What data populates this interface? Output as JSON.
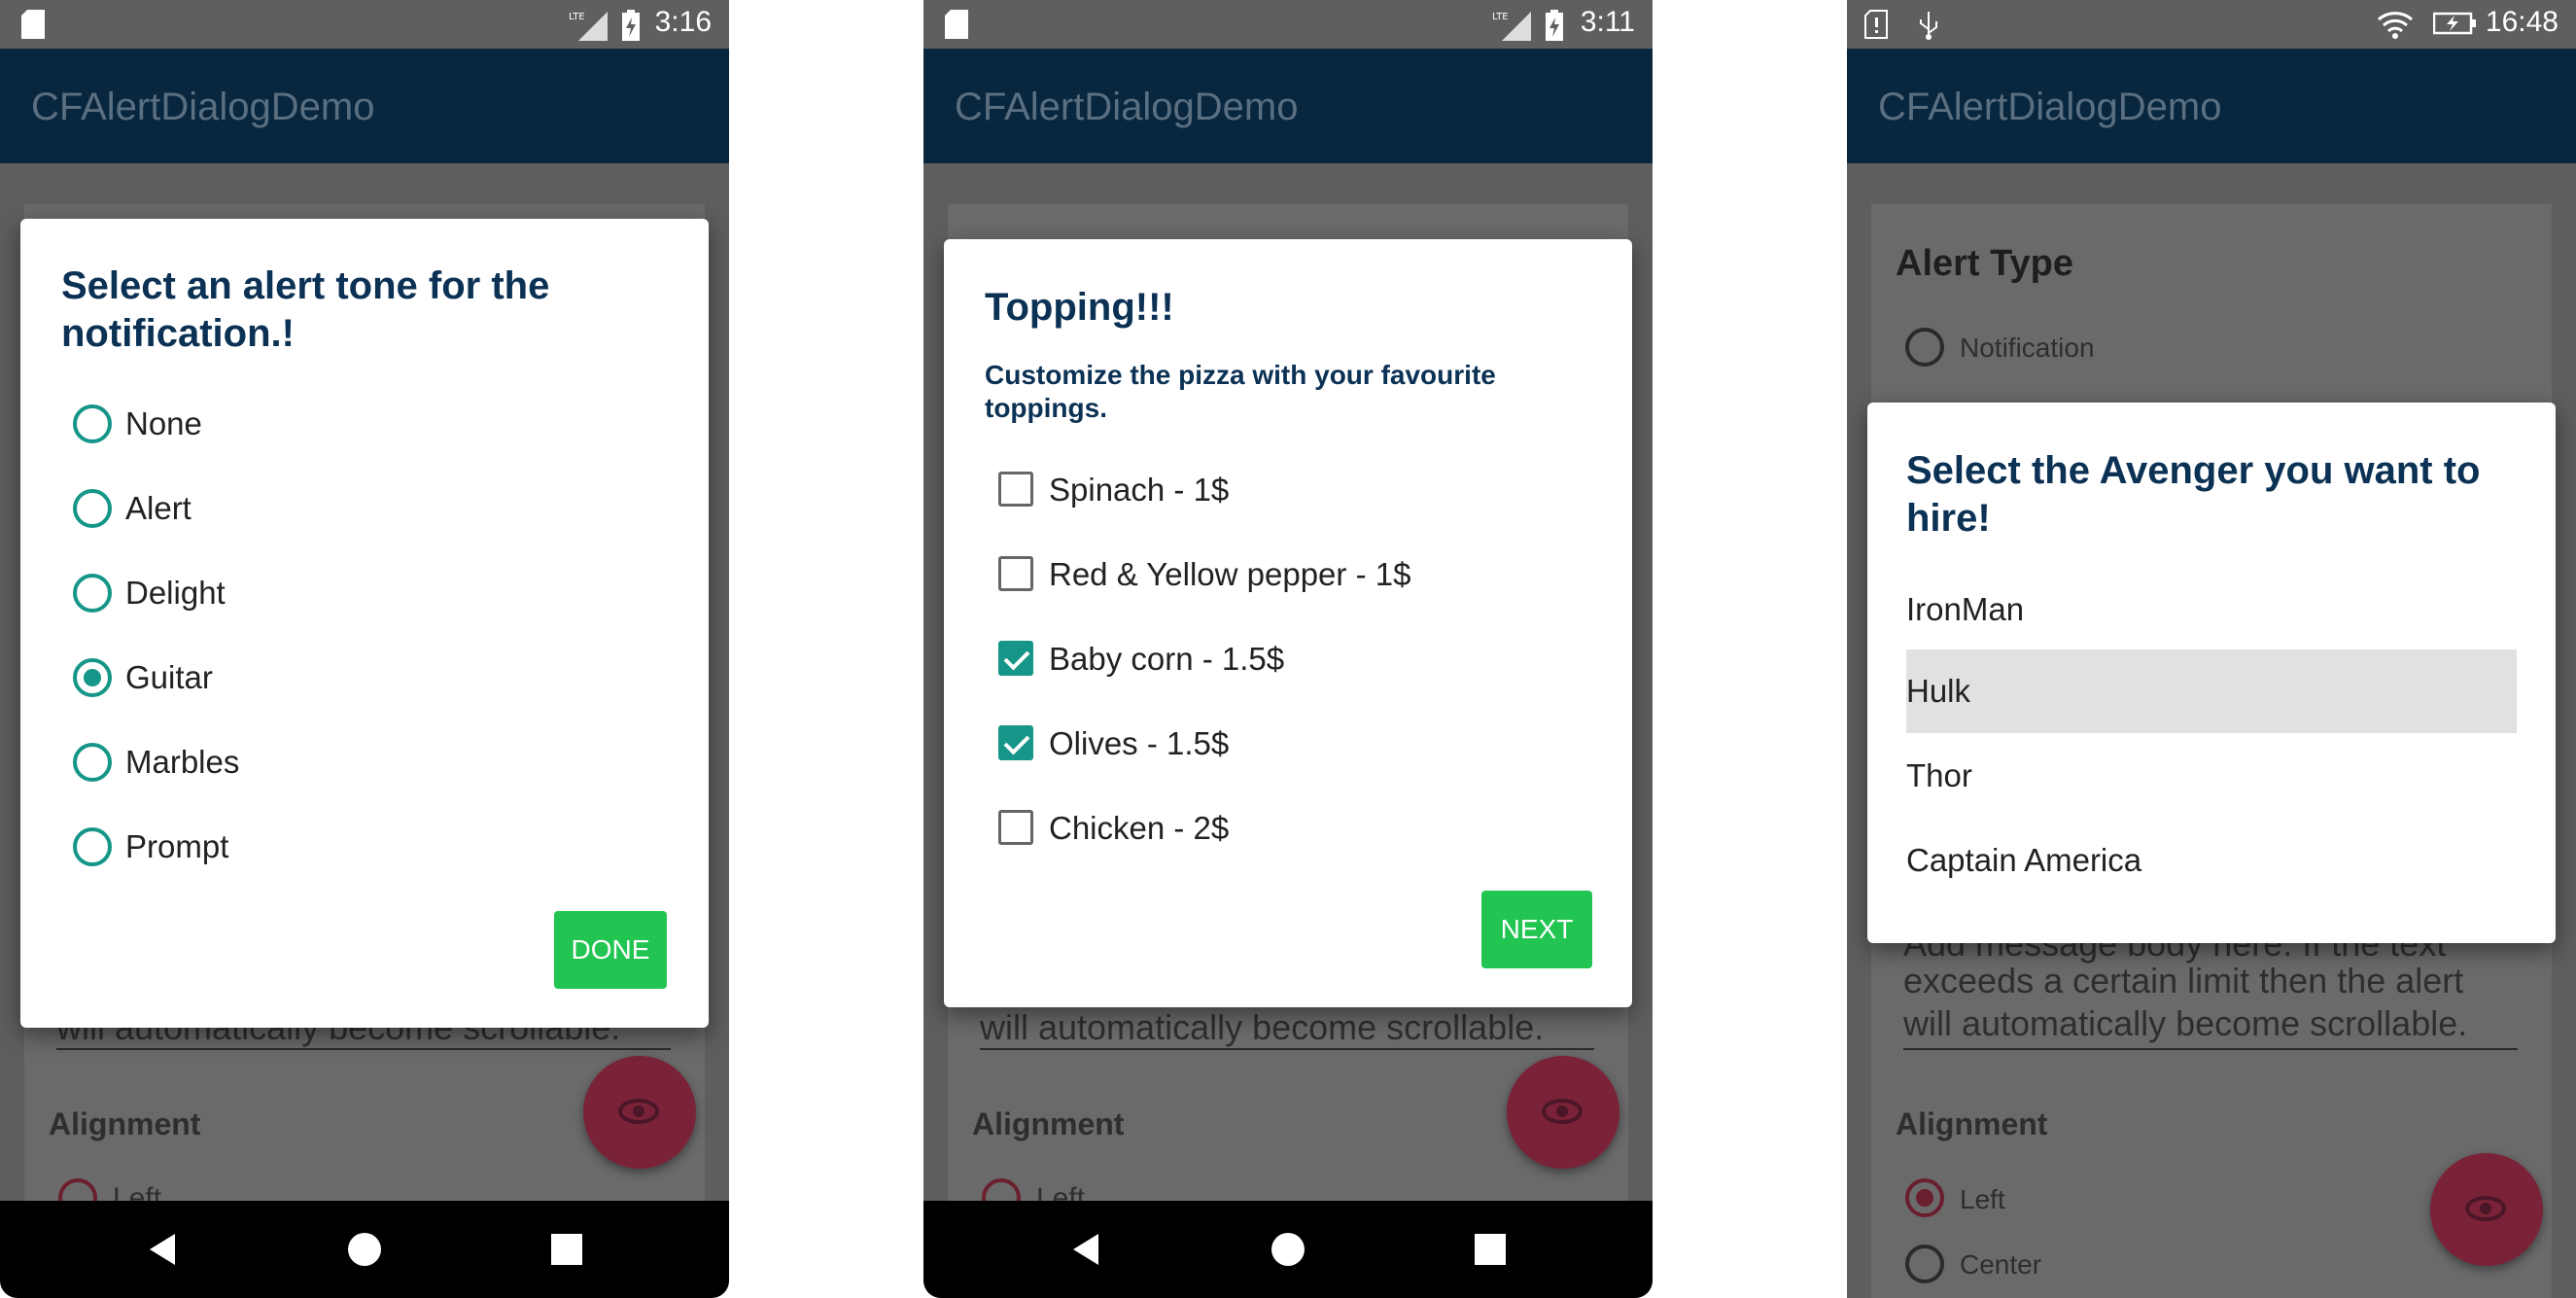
{
  "screens": [
    {
      "status_time": "3:16",
      "app_title": "CFAlertDialogDemo",
      "bg_text": "will automatically become scrollable.",
      "bg_heading": "Alignment",
      "bg_radio": "Left",
      "dialog": {
        "title": "Select an alert tone for the notification.!",
        "options": [
          {
            "label": "None",
            "checked": false
          },
          {
            "label": "Alert",
            "checked": false
          },
          {
            "label": "Delight",
            "checked": false
          },
          {
            "label": "Guitar",
            "checked": true
          },
          {
            "label": "Marbles",
            "checked": false
          },
          {
            "label": "Prompt",
            "checked": false
          }
        ],
        "button": "DONE"
      }
    },
    {
      "status_time": "3:11",
      "app_title": "CFAlertDialogDemo",
      "bg_text": "will automatically become scrollable.",
      "bg_heading": "Alignment",
      "bg_radio": "Left",
      "dialog": {
        "title": "Topping!!!",
        "message": "Customize the pizza with your favourite toppings.",
        "options": [
          {
            "label": "Spinach - 1$",
            "checked": false
          },
          {
            "label": "Red & Yellow pepper - 1$",
            "checked": false
          },
          {
            "label": "Baby corn - 1.5$",
            "checked": true
          },
          {
            "label": "Olives - 1.5$",
            "checked": true
          },
          {
            "label": "Chicken - 2$",
            "checked": false
          }
        ],
        "button": "NEXT"
      }
    },
    {
      "status_time": "16:48",
      "app_title": "CFAlertDialogDemo",
      "bg_alert_type": "Alert Type",
      "bg_notification": "Notification",
      "bg_text_lines": [
        "Add message body here. If the text",
        "exceeds a certain limit then the alert",
        "will automatically become scrollable."
      ],
      "bg_heading": "Alignment",
      "bg_radio_left": "Left",
      "bg_radio_center": "Center",
      "dialog": {
        "title": "Select the Avenger you want to hire!",
        "items": [
          "IronMan",
          "Hulk",
          "Thor",
          "Captain America"
        ],
        "selected_index": 1
      }
    }
  ]
}
